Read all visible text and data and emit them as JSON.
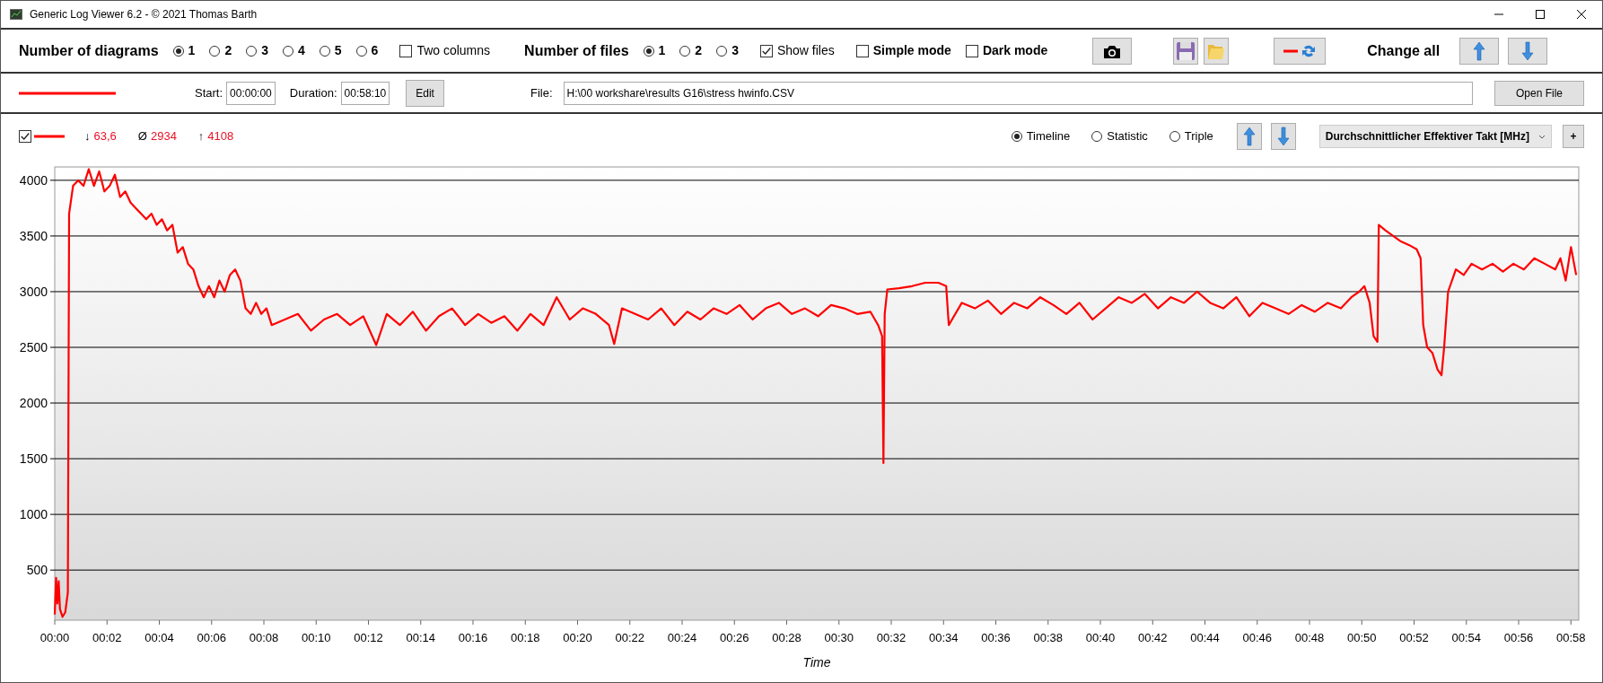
{
  "window": {
    "title": "Generic Log Viewer 6.2 - © 2021 Thomas Barth"
  },
  "toolbar": {
    "diagrams": {
      "label": "Number of diagrams",
      "options": [
        {
          "label": "1",
          "selected": true
        },
        {
          "label": "2",
          "selected": false
        },
        {
          "label": "3",
          "selected": false
        },
        {
          "label": "4",
          "selected": false
        },
        {
          "label": "5",
          "selected": false
        },
        {
          "label": "6",
          "selected": false
        }
      ]
    },
    "two_columns": {
      "label": "Two columns",
      "checked": false
    },
    "files": {
      "label": "Number of files",
      "options": [
        {
          "label": "1",
          "selected": true
        },
        {
          "label": "2",
          "selected": false
        },
        {
          "label": "3",
          "selected": false
        }
      ]
    },
    "show_files": {
      "label": "Show files",
      "checked": true
    },
    "simple_mode": {
      "label": "Simple mode",
      "checked": false
    },
    "dark_mode": {
      "label": "Dark mode",
      "checked": false
    },
    "change_all": {
      "label": "Change all"
    }
  },
  "file_row": {
    "start_label": "Start:",
    "start": "00:00:00",
    "duration_label": "Duration:",
    "duration": "00:58:10",
    "edit": "Edit",
    "file_label": "File:",
    "file": "H:\\00 workshare\\results G16\\stress hwinfo.CSV",
    "open": "Open File"
  },
  "diagram": {
    "visible": true,
    "stats": [
      {
        "symbol": "↓",
        "value": "63,6"
      },
      {
        "symbol": "Ø",
        "value": "2934"
      },
      {
        "symbol": "↑",
        "value": "4108"
      }
    ],
    "modes": [
      {
        "label": "Timeline",
        "selected": true
      },
      {
        "label": "Statistic",
        "selected": false
      },
      {
        "label": "Triple",
        "selected": false
      }
    ],
    "channel": "Durchschnittlicher Effektiver Takt [MHz]",
    "add": "+",
    "chart_data": {
      "type": "line",
      "xlabel": "Time",
      "xlim": [
        0,
        58.3
      ],
      "ylim": [
        50,
        4120
      ],
      "xticks": [
        {
          "value": 0,
          "label": "00:00"
        },
        {
          "value": 2,
          "label": "00:02"
        },
        {
          "value": 4,
          "label": "00:04"
        },
        {
          "value": 6,
          "label": "00:06"
        },
        {
          "value": 8,
          "label": "00:08"
        },
        {
          "value": 10,
          "label": "00:10"
        },
        {
          "value": 12,
          "label": "00:12"
        },
        {
          "value": 14,
          "label": "00:14"
        },
        {
          "value": 16,
          "label": "00:16"
        },
        {
          "value": 18,
          "label": "00:18"
        },
        {
          "value": 20,
          "label": "00:20"
        },
        {
          "value": 22,
          "label": "00:22"
        },
        {
          "value": 24,
          "label": "00:24"
        },
        {
          "value": 26,
          "label": "00:26"
        },
        {
          "value": 28,
          "label": "00:28"
        },
        {
          "value": 30,
          "label": "00:30"
        },
        {
          "value": 32,
          "label": "00:32"
        },
        {
          "value": 34,
          "label": "00:34"
        },
        {
          "value": 36,
          "label": "00:36"
        },
        {
          "value": 38,
          "label": "00:38"
        },
        {
          "value": 40,
          "label": "00:40"
        },
        {
          "value": 42,
          "label": "00:42"
        },
        {
          "value": 44,
          "label": "00:44"
        },
        {
          "value": 46,
          "label": "00:46"
        },
        {
          "value": 48,
          "label": "00:48"
        },
        {
          "value": 50,
          "label": "00:50"
        },
        {
          "value": 52,
          "label": "00:52"
        },
        {
          "value": 54,
          "label": "00:54"
        },
        {
          "value": 56,
          "label": "00:56"
        },
        {
          "value": 58,
          "label": "00:58"
        }
      ],
      "yticks": [
        500,
        1000,
        1500,
        2000,
        2500,
        3000,
        3500,
        4000
      ],
      "x": [
        0,
        0.05,
        0.1,
        0.15,
        0.2,
        0.3,
        0.4,
        0.5,
        0.55,
        0.7,
        0.9,
        1.1,
        1.3,
        1.5,
        1.7,
        1.9,
        2.1,
        2.3,
        2.5,
        2.7,
        2.9,
        3.1,
        3.3,
        3.5,
        3.7,
        3.9,
        4.1,
        4.3,
        4.5,
        4.7,
        4.9,
        5.1,
        5.3,
        5.5,
        5.7,
        5.9,
        6.1,
        6.3,
        6.5,
        6.7,
        6.9,
        7.1,
        7.3,
        7.5,
        7.7,
        7.9,
        8.1,
        8.3,
        8.8,
        9.3,
        9.8,
        10.3,
        10.8,
        11.3,
        11.8,
        12.3,
        12.7,
        13.2,
        13.7,
        14.2,
        14.7,
        15.2,
        15.7,
        16.2,
        16.7,
        17.2,
        17.7,
        18.2,
        18.7,
        19.2,
        19.7,
        20.2,
        20.7,
        21.2,
        21.4,
        21.7,
        22.2,
        22.7,
        23.2,
        23.7,
        24.2,
        24.7,
        25.2,
        25.7,
        26.2,
        26.7,
        27.2,
        27.7,
        28.2,
        28.7,
        29.2,
        29.7,
        30.2,
        30.7,
        31.2,
        31.5,
        31.65,
        31.7,
        31.75,
        31.85,
        32.3,
        32.8,
        33.3,
        33.8,
        34.1,
        34.2,
        34.7,
        35.2,
        35.7,
        36.2,
        36.7,
        37.2,
        37.7,
        38.2,
        38.7,
        39.2,
        39.7,
        40.2,
        40.7,
        41.2,
        41.7,
        42.2,
        42.7,
        43.2,
        43.7,
        44.2,
        44.7,
        45.2,
        45.7,
        46.2,
        46.7,
        47.2,
        47.7,
        48.2,
        48.7,
        49.2,
        49.6,
        49.9,
        50.1,
        50.3,
        50.45,
        50.6,
        50.65,
        50.9,
        51.2,
        51.5,
        51.8,
        52.1,
        52.25,
        52.35,
        52.5,
        52.7,
        52.9,
        53.05,
        53.15,
        53.3,
        53.6,
        53.9,
        54.2,
        54.6,
        55,
        55.4,
        55.8,
        56.2,
        56.6,
        57,
        57.4,
        57.6,
        57.8,
        58,
        58.2
      ],
      "grid": true,
      "series": [
        {
          "color": "#ff0000",
          "values": [
            100,
            430,
            200,
            400,
            150,
            80,
            120,
            300,
            3700,
            3950,
            4000,
            3950,
            4100,
            3950,
            4080,
            3900,
            3950,
            4050,
            3850,
            3900,
            3800,
            3750,
            3700,
            3650,
            3700,
            3600,
            3650,
            3550,
            3600,
            3350,
            3400,
            3250,
            3200,
            3050,
            2950,
            3050,
            2950,
            3100,
            3000,
            3150,
            3200,
            3100,
            2850,
            2800,
            2900,
            2800,
            2850,
            2700,
            2750,
            2800,
            2650,
            2750,
            2800,
            2700,
            2780,
            2520,
            2800,
            2700,
            2820,
            2650,
            2780,
            2850,
            2700,
            2800,
            2720,
            2780,
            2650,
            2800,
            2700,
            2950,
            2750,
            2850,
            2800,
            2700,
            2530,
            2850,
            2800,
            2750,
            2850,
            2700,
            2820,
            2750,
            2850,
            2800,
            2880,
            2750,
            2850,
            2900,
            2800,
            2850,
            2780,
            2880,
            2850,
            2800,
            2820,
            2700,
            2600,
            1460,
            2800,
            3020,
            3030,
            3050,
            3080,
            3080,
            3050,
            2700,
            2900,
            2850,
            2920,
            2800,
            2900,
            2850,
            2950,
            2880,
            2800,
            2900,
            2750,
            2850,
            2950,
            2900,
            2980,
            2850,
            2950,
            2900,
            3000,
            2900,
            2850,
            2950,
            2780,
            2900,
            2850,
            2800,
            2880,
            2820,
            2900,
            2850,
            2950,
            3000,
            3050,
            2900,
            2600,
            2550,
            3600,
            3550,
            3500,
            3450,
            3420,
            3380,
            3300,
            2700,
            2500,
            2450,
            2300,
            2250,
            2500,
            3000,
            3200,
            3150,
            3250,
            3200,
            3250,
            3180,
            3250,
            3200,
            3300,
            3250,
            3200,
            3300,
            3100,
            3400,
            3150
          ]
        }
      ]
    }
  }
}
